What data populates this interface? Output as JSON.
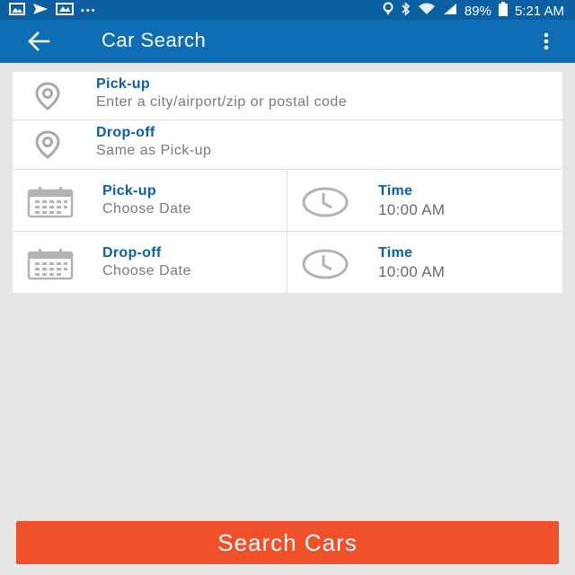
{
  "status_bar": {
    "more_dots": "•••",
    "battery": "89%",
    "time": "5:21 AM",
    "icons": [
      "image-icon",
      "message-icon",
      "gallery-icon",
      "location-icon",
      "bluetooth-icon",
      "wifi-icon",
      "signal-icon",
      "battery-icon"
    ]
  },
  "app_bar": {
    "title": "Car Search",
    "back_icon": "arrow-left-icon",
    "menu_icon": "more-vertical-icon"
  },
  "form": {
    "pickup_location": {
      "label": "Pick-up",
      "placeholder": "Enter a city/airport/zip or postal code"
    },
    "dropoff_location": {
      "label": "Drop-off",
      "value": "Same as Pick-up"
    },
    "pickup_date": {
      "label": "Pick-up",
      "value": "Choose Date"
    },
    "pickup_time": {
      "label": "Time",
      "value": "10:00 AM"
    },
    "dropoff_date": {
      "label": "Drop-off",
      "value": "Choose Date"
    },
    "dropoff_time": {
      "label": "Time",
      "value": "10:00 AM"
    }
  },
  "search_button": {
    "label": "Search Cars",
    "color": "#f0512a"
  },
  "colors": {
    "app_bar": "#0e6db5",
    "label": "#0d5fa3",
    "background": "#e6e6e6"
  }
}
